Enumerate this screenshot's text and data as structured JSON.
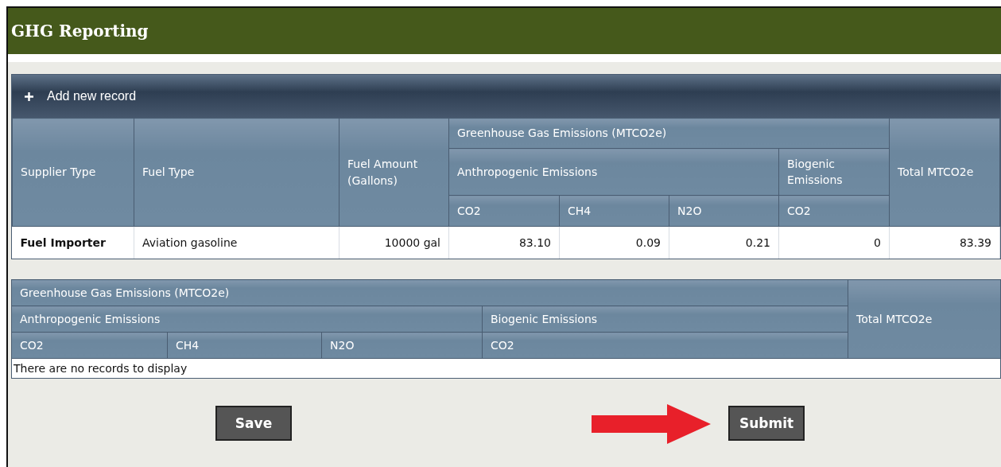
{
  "title": "GHG Reporting",
  "records_table": {
    "add_button": "Add new record",
    "columns": {
      "supplier": "Supplier Type",
      "fuel": "Fuel Type",
      "amount": "Fuel Amount (Gallons)",
      "group": "Greenhouse Gas Emissions (MTCO2e)",
      "anthro": "Anthropogenic Emissions",
      "anthro_gases": [
        "CO2",
        "CH4",
        "N2O"
      ],
      "bio": "Biogenic Emissions",
      "bio_gases": [
        "CO2"
      ],
      "total": "Total MTCO2e"
    },
    "rows": [
      {
        "cells": [
          "Fuel Importer",
          "Aviation gasoline",
          "10000 gal",
          "83.10",
          "0.09",
          "0.21",
          "0",
          "83.39"
        ]
      }
    ]
  },
  "summary_table": {
    "columns": {
      "group": "Greenhouse Gas Emissions (MTCO2e)",
      "anthro": "Anthropogenic Emissions",
      "anthro_gases": [
        "CO2",
        "CH4",
        "N2O"
      ],
      "bio": "Biogenic Emissions",
      "bio_gases": [
        "CO2"
      ],
      "total": "Total MTCO2e"
    },
    "empty_message": "There are no records to display"
  },
  "buttons": [
    {
      "label": "Save"
    },
    {
      "label": "Submit"
    }
  ]
}
